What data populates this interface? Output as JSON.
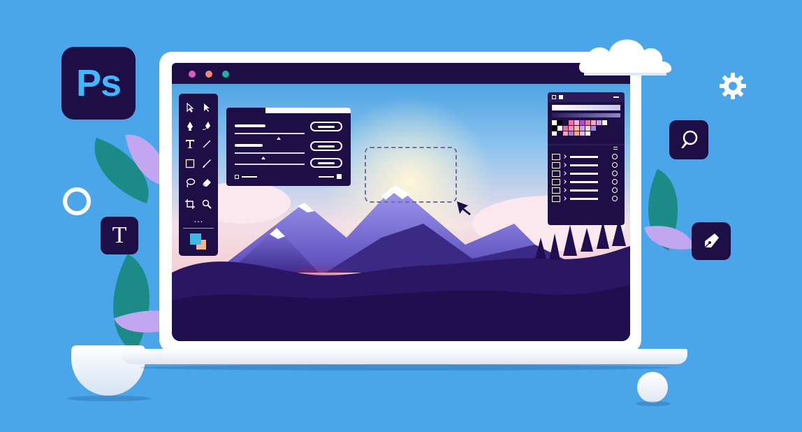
{
  "app": {
    "logo_text": "Ps",
    "type_icon_text": "T"
  },
  "icons": {
    "logo": "photoshop-logo",
    "type": "type-tool-icon",
    "settings": "gear-icon",
    "brush": "brush-icon",
    "pen": "pen-tool-icon",
    "cursor": "cursor-arrow-icon"
  },
  "window": {
    "traffic_lights": [
      "#d85bc4",
      "#f08a70",
      "#21b19a"
    ]
  },
  "toolbar": {
    "tools": [
      "direct-select-icon",
      "select-arrow-icon",
      "pen-icon",
      "freeform-pen-icon",
      "text-tool-icon",
      "line-tool-icon",
      "rectangle-icon",
      "brush-icon",
      "lasso-icon",
      "eraser-icon",
      "crop-icon",
      "zoom-icon"
    ],
    "more": "…"
  },
  "colors": {
    "background": "#4aa6e8",
    "dark_navy": "#1d0f45",
    "foreground_swatch": "#3fb8e8",
    "background_swatch": "#f3b596"
  }
}
